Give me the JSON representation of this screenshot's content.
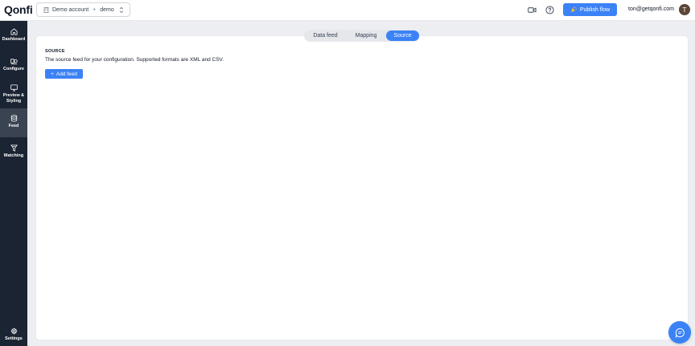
{
  "app": {
    "logo": "Qonfi"
  },
  "header": {
    "account": "Demo account",
    "separator": "+",
    "environment": "demo",
    "publish_label": "Publish flow",
    "user_email": "ton@getqonfi.com",
    "avatar_initial": "T"
  },
  "sidebar": {
    "items": [
      {
        "label": "Dashboard",
        "icon": "home-icon"
      },
      {
        "label": "Configure",
        "icon": "configure-icon"
      },
      {
        "label": "Preview &",
        "label2": "Styling",
        "icon": "monitor-icon"
      },
      {
        "label": "Feed",
        "icon": "database-icon"
      },
      {
        "label": "Matching",
        "icon": "funnel-icon"
      }
    ],
    "settings_label": "Settings"
  },
  "tabs": [
    {
      "label": "Data feed",
      "active": false
    },
    {
      "label": "Mapping",
      "active": false
    },
    {
      "label": "Source",
      "active": true
    }
  ],
  "source": {
    "title": "SOURCE",
    "description": "The source feed for your configuration. Supported formats are XML and CSV.",
    "add_button": "Add feed",
    "add_button_prefix": "+"
  },
  "colors": {
    "accent": "#3b82f6",
    "sidebar_bg": "#1b2433",
    "sidebar_active": "#3a4352"
  }
}
